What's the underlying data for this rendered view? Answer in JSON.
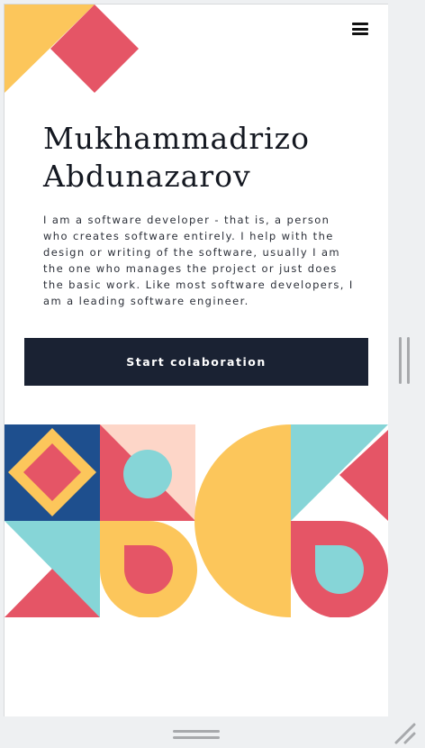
{
  "profile": {
    "first_name": "Mukhammadrizo",
    "last_name": "Abdunazarov",
    "bio": "I am a software developer - that is, a person who creates software entirely. I help with the design or writing of the software, usually I am the one who manages the project or just does the basic work. Like most software developers, I am a leading software engineer."
  },
  "actions": {
    "cta_label": "Start colaboration"
  },
  "icons": {
    "menu": "hamburger-menu-icon",
    "resize": "resize-grip-icon"
  },
  "colors": {
    "navy": "#1a2233",
    "yellow": "#fcc65b",
    "red": "#e55566",
    "cyan": "#86d5d7",
    "blue": "#1e4f8e",
    "peach": "#fdd6c8"
  }
}
